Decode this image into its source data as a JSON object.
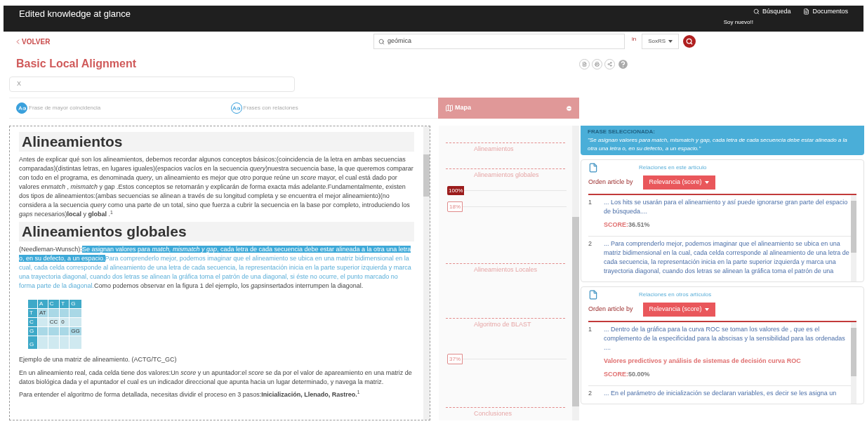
{
  "header": {
    "brand": "Edited knowledge at glance",
    "links": [
      {
        "label": "Búsqueda",
        "kind": "search"
      },
      {
        "label": "Documentos",
        "kind": "document"
      }
    ],
    "user_note": "Soy nuevo!!"
  },
  "back_link": "VOLVER",
  "search": {
    "value": "geómica",
    "scope_label": "in",
    "scope": "SoxRS"
  },
  "title": "Basic Local Alignment",
  "filter": {
    "value": "X"
  },
  "tabs": [
    {
      "label": "Frase de mayor coincidencia",
      "selected": true
    },
    {
      "label": "Frases con relaciones",
      "selected": false
    }
  ],
  "map": {
    "title": "Mapa",
    "items": [
      {
        "kind": "section",
        "label": "Alineamientos"
      },
      {
        "kind": "section",
        "label": "Alineamientos globales"
      },
      {
        "kind": "marker",
        "label": "100%",
        "selected": true
      },
      {
        "kind": "marker",
        "label": "18%",
        "selected": false
      },
      {
        "kind": "section",
        "label": "Alineamientos Locales"
      },
      {
        "kind": "section",
        "label": "Algoritmo de BLAST"
      },
      {
        "kind": "marker",
        "label": "37%",
        "selected": false
      },
      {
        "kind": "section",
        "label": "Conclusiones"
      }
    ]
  },
  "article": [
    {
      "kind": "heading",
      "text": "Alineamientos"
    },
    {
      "kind": "paragraph",
      "segments": [
        {
          "kind": "plain",
          "text": "Antes de explicar qué son los alineamientos, debemos recordar algunos conceptos básicos:(coincidencia de la letra en ambas secuencias comparadas)(distintas letras, en lugares iguales)(espacios vacíos en la secuencia *query*)nuestra secuencia base, la que queremos comparar con todo en el programa, es denominada *query*, un alineamiento es mejor que otro porque reúne un *score* mayor, el cual está dado por valores en"
        },
        {
          "kind": "emphasis",
          "text": "match"
        },
        {
          "kind": "plain",
          "text": " , *mismatch* y gap .Estos conceptos se retomarán y explicarán de forma exacta más adelante.Fundamentalmente, existen dos tipos de alineamientos:(ambas secuencias se alinean a través de su longitud completa y se encuentra el mejor alineamiento)(no considera a la secuencia *query* como una parte de un total, sino que fuerza a cubrir la secuencia en la base por completo, introduciendo los *gaps* necesarios)**local** y **global** .$^{1}$"
        }
      ]
    },
    {
      "kind": "heading",
      "text": "Alineamientos globales"
    },
    {
      "kind": "paragraph",
      "segments": [
        {
          "kind": "plain",
          "text": "(Needleman-Wunsch):"
        },
        {
          "kind": "selected",
          "text": "Se asignan valores para *match, mismatch y gap*, cada letra de cada secuencia debe estar alineada a la otra una letra o, en su defecto, a un espacio."
        },
        {
          "kind": "related",
          "text": "Para comprenderlo mejor, podemos imaginar que el alineamiento se ubica en una matriz bidimensional en la cual, cada celda corresponde al alineamiento de una letra de cada secuencia, la representación inicia en la parte superior izquierda y marca una trayectoria diagonal, cuando dos letras se alinean la gráfica toma el patrón de una diagonal, si éste no ocurre, el punto marcado no forma parte de la diagonal."
        },
        {
          "kind": "plain",
          "text": "Como podemos observar en la figura 1 del ejemplo, los "
        },
        {
          "kind": "emphasis",
          "text": "gaps"
        },
        {
          "kind": "plain",
          "text": "insertados interrumpen la diagonal."
        }
      ]
    },
    {
      "kind": "matrix",
      "columns": [
        "A",
        "C",
        "T",
        "G"
      ],
      "rows": [
        {
          "head": "T",
          "cells": [
            "AT",
            "",
            "",
            ""
          ]
        },
        {
          "head": "C",
          "cells": [
            "",
            "CC",
            "0",
            ""
          ]
        },
        {
          "head": "G",
          "cells": [
            "",
            "",
            "",
            "GG"
          ]
        },
        {
          "head": "G",
          "cells": [
            "",
            "",
            "",
            ""
          ]
        }
      ]
    },
    {
      "kind": "caption",
      "text": "Ejemplo de una matriz de alineamiento. (ACTG/TC_GC)"
    },
    {
      "kind": "paragraph",
      "segments": [
        {
          "kind": "plain",
          "text": "En un alineamiento real, cada celda tiene dos valores:Un *score* y un apuntador:el *score* se da por el valor de apareamiento en una matriz de datos biológica dada y el apuntador el cual es un indicador direccional que apunta hacia un lugar determinado, y navega la matriz."
        }
      ]
    },
    {
      "kind": "paragraph",
      "segments": [
        {
          "kind": "plain",
          "text": "Para entender el algoritmo de forma detallada, necesitas dividir el proceso en 3 pasos:**Inicialización, Llenado, Rastreo.**$^{1}$"
        }
      ]
    }
  ],
  "selected_phrase": {
    "label": "FRASE SELECCIONADA:",
    "text": "\"Se asignan valores para match, mismatch y gap, cada letra de cada secuencia debe estar alineado a la otra una letra o, en su defecto, a un espacio.\""
  },
  "relation_cards": [
    {
      "title": "Relaciones en este artículo",
      "sort_label": "Orden article by",
      "sort_value": "Relevancia (score)",
      "results": [
        {
          "index": "1",
          "text": "... Los hits se usarán para el alineamiento y así puede ignorarse gran parte del espacio de búsqueda....",
          "score_label": "SCORE:",
          "score": "36.51%"
        },
        {
          "index": "2",
          "text": "... Para comprenderlo mejor, podemos imaginar que el alineamiento se ubica en una matriz bidimensional en la cual, cada celda corresponde al alineamiento de una letra de cada secuencia, la representación inicia en la parte superior izquierda y marca una trayectoria diagonal, cuando dos letras se alinean la gráfica toma el patrón de una"
        }
      ]
    },
    {
      "title": "Relaciones en otros artículos",
      "sort_label": "Orden article by",
      "sort_value": "Relevancia (score)",
      "results": [
        {
          "index": "1",
          "text": "... Dentro de la gráfica para la curva ROC se toman los valores de , que es el complemento de la especificidad para la abscisas y la sensibilidad para las ordenadas ....",
          "source": "Valores predictivos y análisis de sistemas de decisión curva ROC",
          "score_label": "SCORE:",
          "score": "50.00%"
        },
        {
          "index": "2",
          "text": "... En el parámetro de inicialización se declaran variables, es decir se les asigna un"
        }
      ]
    }
  ]
}
